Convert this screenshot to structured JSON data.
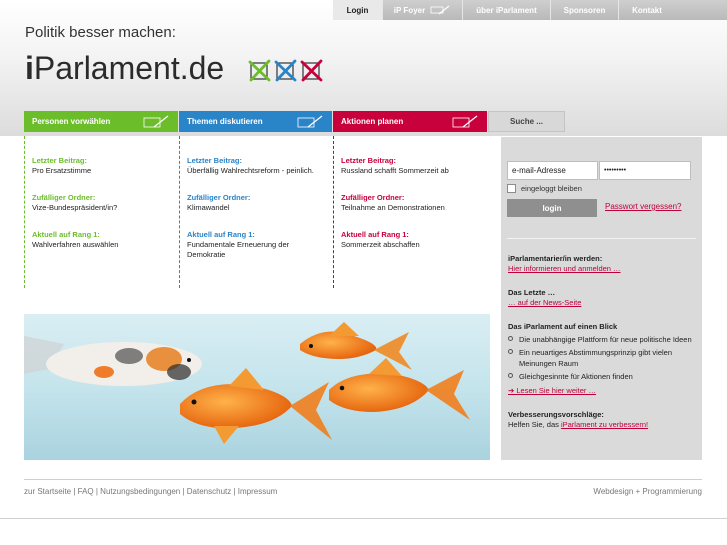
{
  "topnav": [
    {
      "label": "Login",
      "active": true
    },
    {
      "label": "iP Foyer",
      "icon": "pencil-icon"
    },
    {
      "label": "über iParlament"
    },
    {
      "label": "Sponsoren"
    },
    {
      "label": "Kontakt"
    }
  ],
  "header": {
    "slogan": "Politik besser machen:",
    "logo_prefix": "i",
    "logo_rest": "Parlament.de"
  },
  "columns": [
    {
      "tab": "Personen vorwählen",
      "color": "#6cbd2a",
      "h1": "Letzter Beitrag:",
      "t1": "Pro Ersatzstimme",
      "h2": "Zufälliger Ordner:",
      "t2": "Vize-Bundespräsident/in?",
      "h3": "Aktuell auf Rang 1:",
      "t3": "Wahlverfahren auswählen"
    },
    {
      "tab": "Themen diskutieren",
      "color": "#2a84c8",
      "h1": "Letzter Beitrag:",
      "t1": "Überfällig Wahlrechtsreform - peinlich.",
      "h2": "Zufälliger Ordner:",
      "t2": "Klimawandel",
      "h3": "Aktuell auf Rang 1:",
      "t3": "Fundamentale Erneuerung der Demokratie"
    },
    {
      "tab": "Aktionen planen",
      "color": "#c8003c",
      "h1": "Letzter Beitrag:",
      "t1": "Russland schafft Sommerzeit ab",
      "h2": "Zufälliger Ordner:",
      "t2": "Teilnahme an Demonstrationen",
      "h3": "Aktuell auf Rang 1:",
      "t3": "Sommerzeit abschaffen"
    }
  ],
  "search_tab": "Suche ...",
  "login": {
    "email_placeholder": "e-mail-Adresse",
    "password_value": "•••••••••",
    "remember_label": "eingeloggt bleiben",
    "button": "login",
    "forgot_link": "Passwort vergessen?"
  },
  "panel": {
    "register_head": "iParlamentarier/in werden:",
    "register_link": "Hier informieren und anmelden …",
    "latest_head": "Das Letzte …",
    "latest_link": "… auf der News-Seite",
    "overview_head": "Das iParlament auf einen Blick",
    "bullets": [
      "Die unabhängige Plattform für neue politische Ideen",
      "Ein neuartiges Abstimmungsprinzip gibt vielen Meinungen Raum",
      "Gleichgesinnte für Aktionen finden"
    ],
    "read_more": "➔ Lesen Sie hier weiter …",
    "improve_head": "Verbesserungsvorschläge:",
    "improve_text": "Helfen Sie, das ",
    "improve_link": "iParlament zu verbessern!"
  },
  "footer": {
    "links": "zur Startseite | FAQ | Nutzungsbedingungen | Datenschutz | Impressum",
    "credit": "Webdesign + Programmierung"
  },
  "colors": {
    "green": "#6cbd2a",
    "blue": "#2a84c8",
    "red": "#c8003c",
    "link": "#c0003a"
  }
}
